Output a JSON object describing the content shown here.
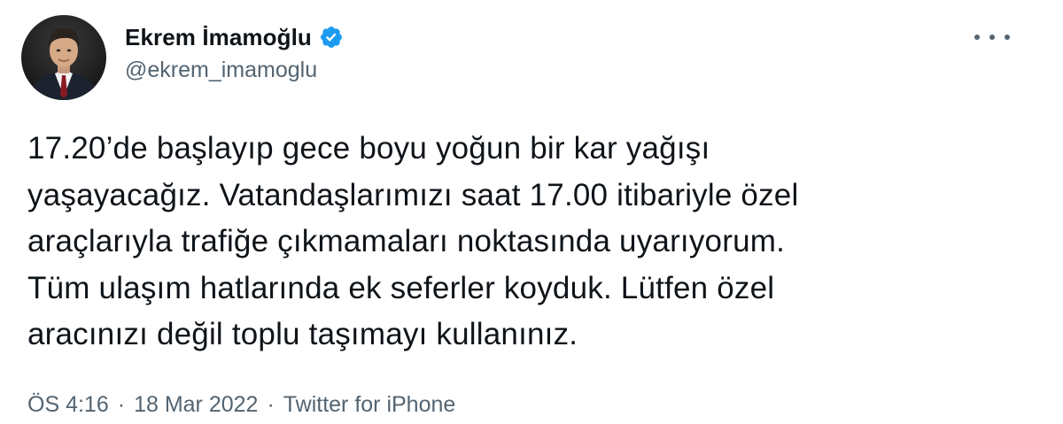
{
  "author": {
    "display_name": "Ekrem İmamoğlu",
    "handle": "@ekrem_imamoglu",
    "verified": true,
    "verified_color": "#1d9bf0"
  },
  "tweet": {
    "text": "17.20’de başlayıp gece boyu yoğun bir kar yağışı\nyaşayacağız. Vatandaşlarımızı saat 17.00 itibariyle  özel\naraçlarıyla trafiğe çıkmamaları noktasında uyarıyorum.\nTüm ulaşım hatlarında ek seferler koyduk. Lütfen özel\naracınızı değil toplu taşımayı kullanınız."
  },
  "meta": {
    "time": "ÖS 4:16",
    "separator": "·",
    "date": "18 Mar 2022",
    "source": "Twitter for iPhone"
  },
  "icons": {
    "more": "more-icon",
    "verified": "verified-badge-icon"
  },
  "colors": {
    "text_primary": "#0f1419",
    "text_secondary": "#536471",
    "accent": "#1d9bf0"
  }
}
